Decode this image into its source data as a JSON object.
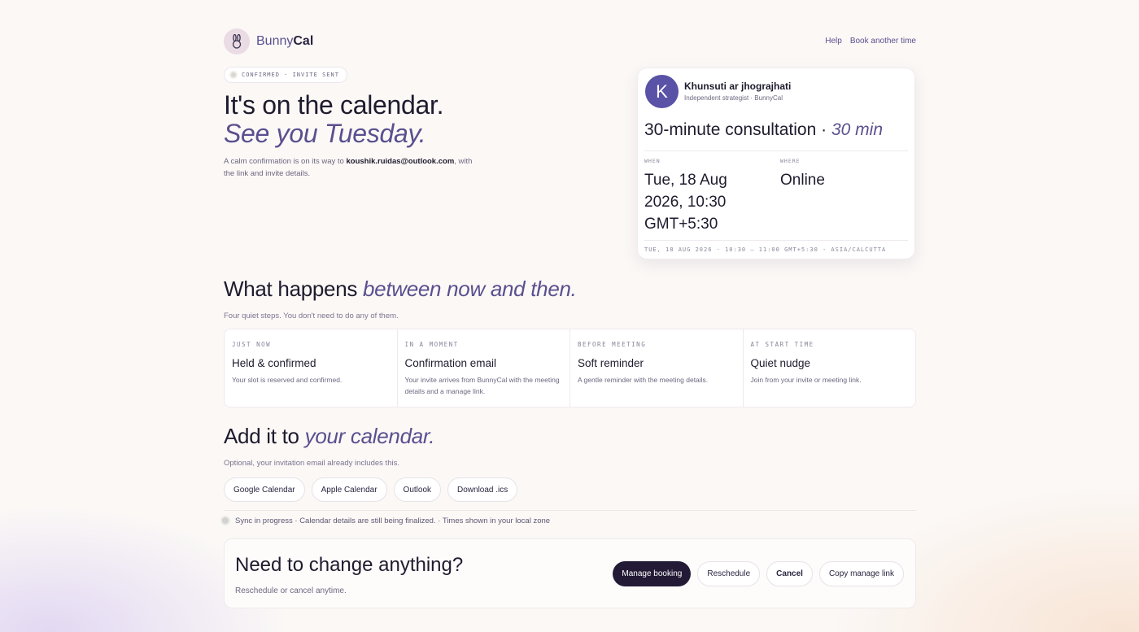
{
  "brand": {
    "name_light": "Bunny",
    "name_bold": "Cal",
    "logo_icon": "rabbit-icon"
  },
  "nav": {
    "help": "Help",
    "book_another": "Book another time"
  },
  "status_pill": "CONFIRMED · INVITE SENT",
  "hero": {
    "title": "It's on the calendar.",
    "title_italic": "See you Tuesday.",
    "sub_before": "A calm confirmation is on its way to ",
    "email": "koushik.ruidas@outlook.com",
    "sub_after": ", with the link and invite details."
  },
  "booking": {
    "avatar_letter": "K",
    "host_name": "Khunsuti ar jhograjhati",
    "host_sub": "Independent strategist · BunnyCal",
    "meeting_name": "30-minute consultation · ",
    "duration": "30 min",
    "when_label": "WHEN",
    "when_value": "Tue, 18 Aug 2026, 10:30 GMT+5:30",
    "where_label": "WHERE",
    "where_value": "Online",
    "footer": "TUE, 18 AUG 2026 · 10:30 – 11:00 GMT+5:30 · ASIA/CALCUTTA"
  },
  "timeline": {
    "title": "What happens ",
    "title_italic": "between now and then.",
    "subtitle": "Four quiet steps. You don't need to do any of them.",
    "steps": [
      {
        "key": "JUST NOW",
        "title": "Held & confirmed",
        "desc": "Your slot is reserved and confirmed."
      },
      {
        "key": "IN A MOMENT",
        "title": "Confirmation email",
        "desc": "Your invite arrives from BunnyCal with the meeting details and a manage link."
      },
      {
        "key": "BEFORE MEETING",
        "title": "Soft reminder",
        "desc": "A gentle reminder with the meeting details."
      },
      {
        "key": "AT START TIME",
        "title": "Quiet nudge",
        "desc": "Join from your invite or meeting link."
      }
    ]
  },
  "calendar": {
    "title": "Add it to ",
    "title_italic": "your calendar.",
    "subtitle": "Optional, your invitation email already includes this.",
    "buttons": [
      "Google Calendar",
      "Apple Calendar",
      "Outlook",
      "Download .ics"
    ]
  },
  "sync": "Sync in progress · Calendar details are still being finalized. · Times shown in your local zone",
  "change": {
    "title": "Need to change anything?",
    "subtitle": "Reschedule or cancel anytime.",
    "manage": "Manage booking",
    "reschedule": "Reschedule",
    "cancel": "Cancel",
    "copy_link": "Copy manage link"
  },
  "colors": {
    "accent": "#5b4f8f",
    "avatar": "#5a52a6",
    "dark_button": "#231a36"
  }
}
